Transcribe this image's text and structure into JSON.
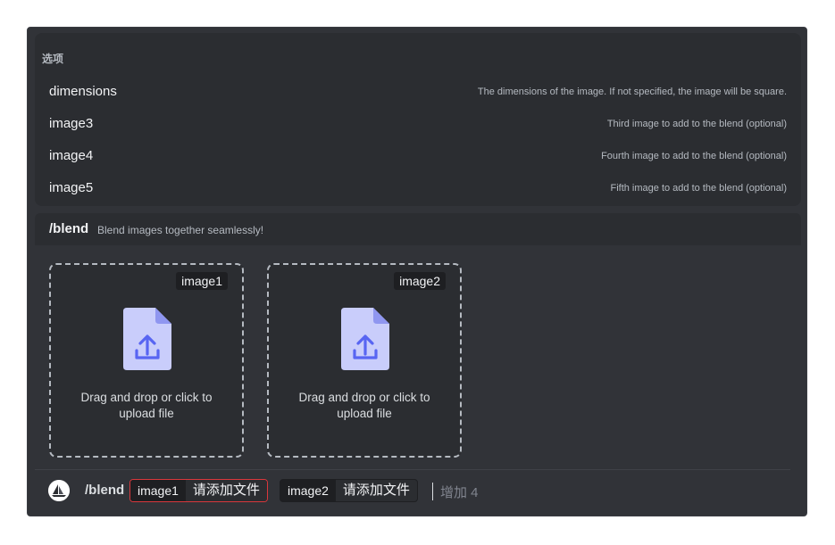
{
  "options": {
    "title": "选项",
    "items": [
      {
        "name": "dimensions",
        "desc": "The dimensions of the image. If not specified, the image will be square."
      },
      {
        "name": "image3",
        "desc": "Third image to add to the blend (optional)"
      },
      {
        "name": "image4",
        "desc": "Fourth image to add to the blend (optional)"
      },
      {
        "name": "image5",
        "desc": "Fifth image to add to the blend (optional)"
      }
    ]
  },
  "command": {
    "name": "/blend",
    "desc": "Blend images together seamlessly!"
  },
  "uploads": [
    {
      "tag": "image1",
      "text": "Drag and drop or click to upload file"
    },
    {
      "tag": "image2",
      "text": "Drag and drop or click to upload file"
    }
  ],
  "input_bar": {
    "cmd": "/blend",
    "params": [
      {
        "name": "image1",
        "value": "请添加文件"
      },
      {
        "name": "image2",
        "value": "请添加文件"
      }
    ],
    "more": "增加 4"
  },
  "colors": {
    "background": "#313338",
    "panel": "#2b2d31",
    "accent": "#5865f2",
    "icon_fill": "#c9cdfb",
    "error_border": "#da373c"
  },
  "icons": {
    "upload": "file-upload-icon",
    "bot": "sailboat-avatar-icon"
  }
}
